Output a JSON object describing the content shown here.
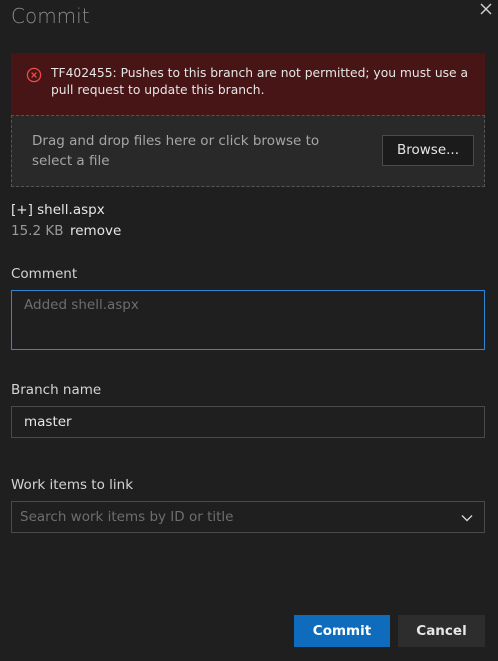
{
  "dialog": {
    "title": "Commit",
    "close_icon": "close-icon"
  },
  "error": {
    "icon": "error-circle-icon",
    "message": "TF402455: Pushes to this branch are not permitted; you must use a pull request to update this branch.",
    "color": "#471516"
  },
  "upload": {
    "drop_text": "Drag and drop files here or click browse to select a file",
    "browse_label": "Browse..."
  },
  "file": {
    "name": "[+] shell.aspx",
    "size": "15.2 KB",
    "remove_label": "remove"
  },
  "comment": {
    "label": "Comment",
    "placeholder": "Added shell.aspx",
    "value": ""
  },
  "branch": {
    "label": "Branch name",
    "value": "master"
  },
  "work_items": {
    "label": "Work items to link",
    "placeholder": "Search work items by ID or title",
    "chevron_icon": "chevron-down-icon"
  },
  "footer": {
    "commit_label": "Commit",
    "cancel_label": "Cancel",
    "accent": "#0f6cbd"
  }
}
